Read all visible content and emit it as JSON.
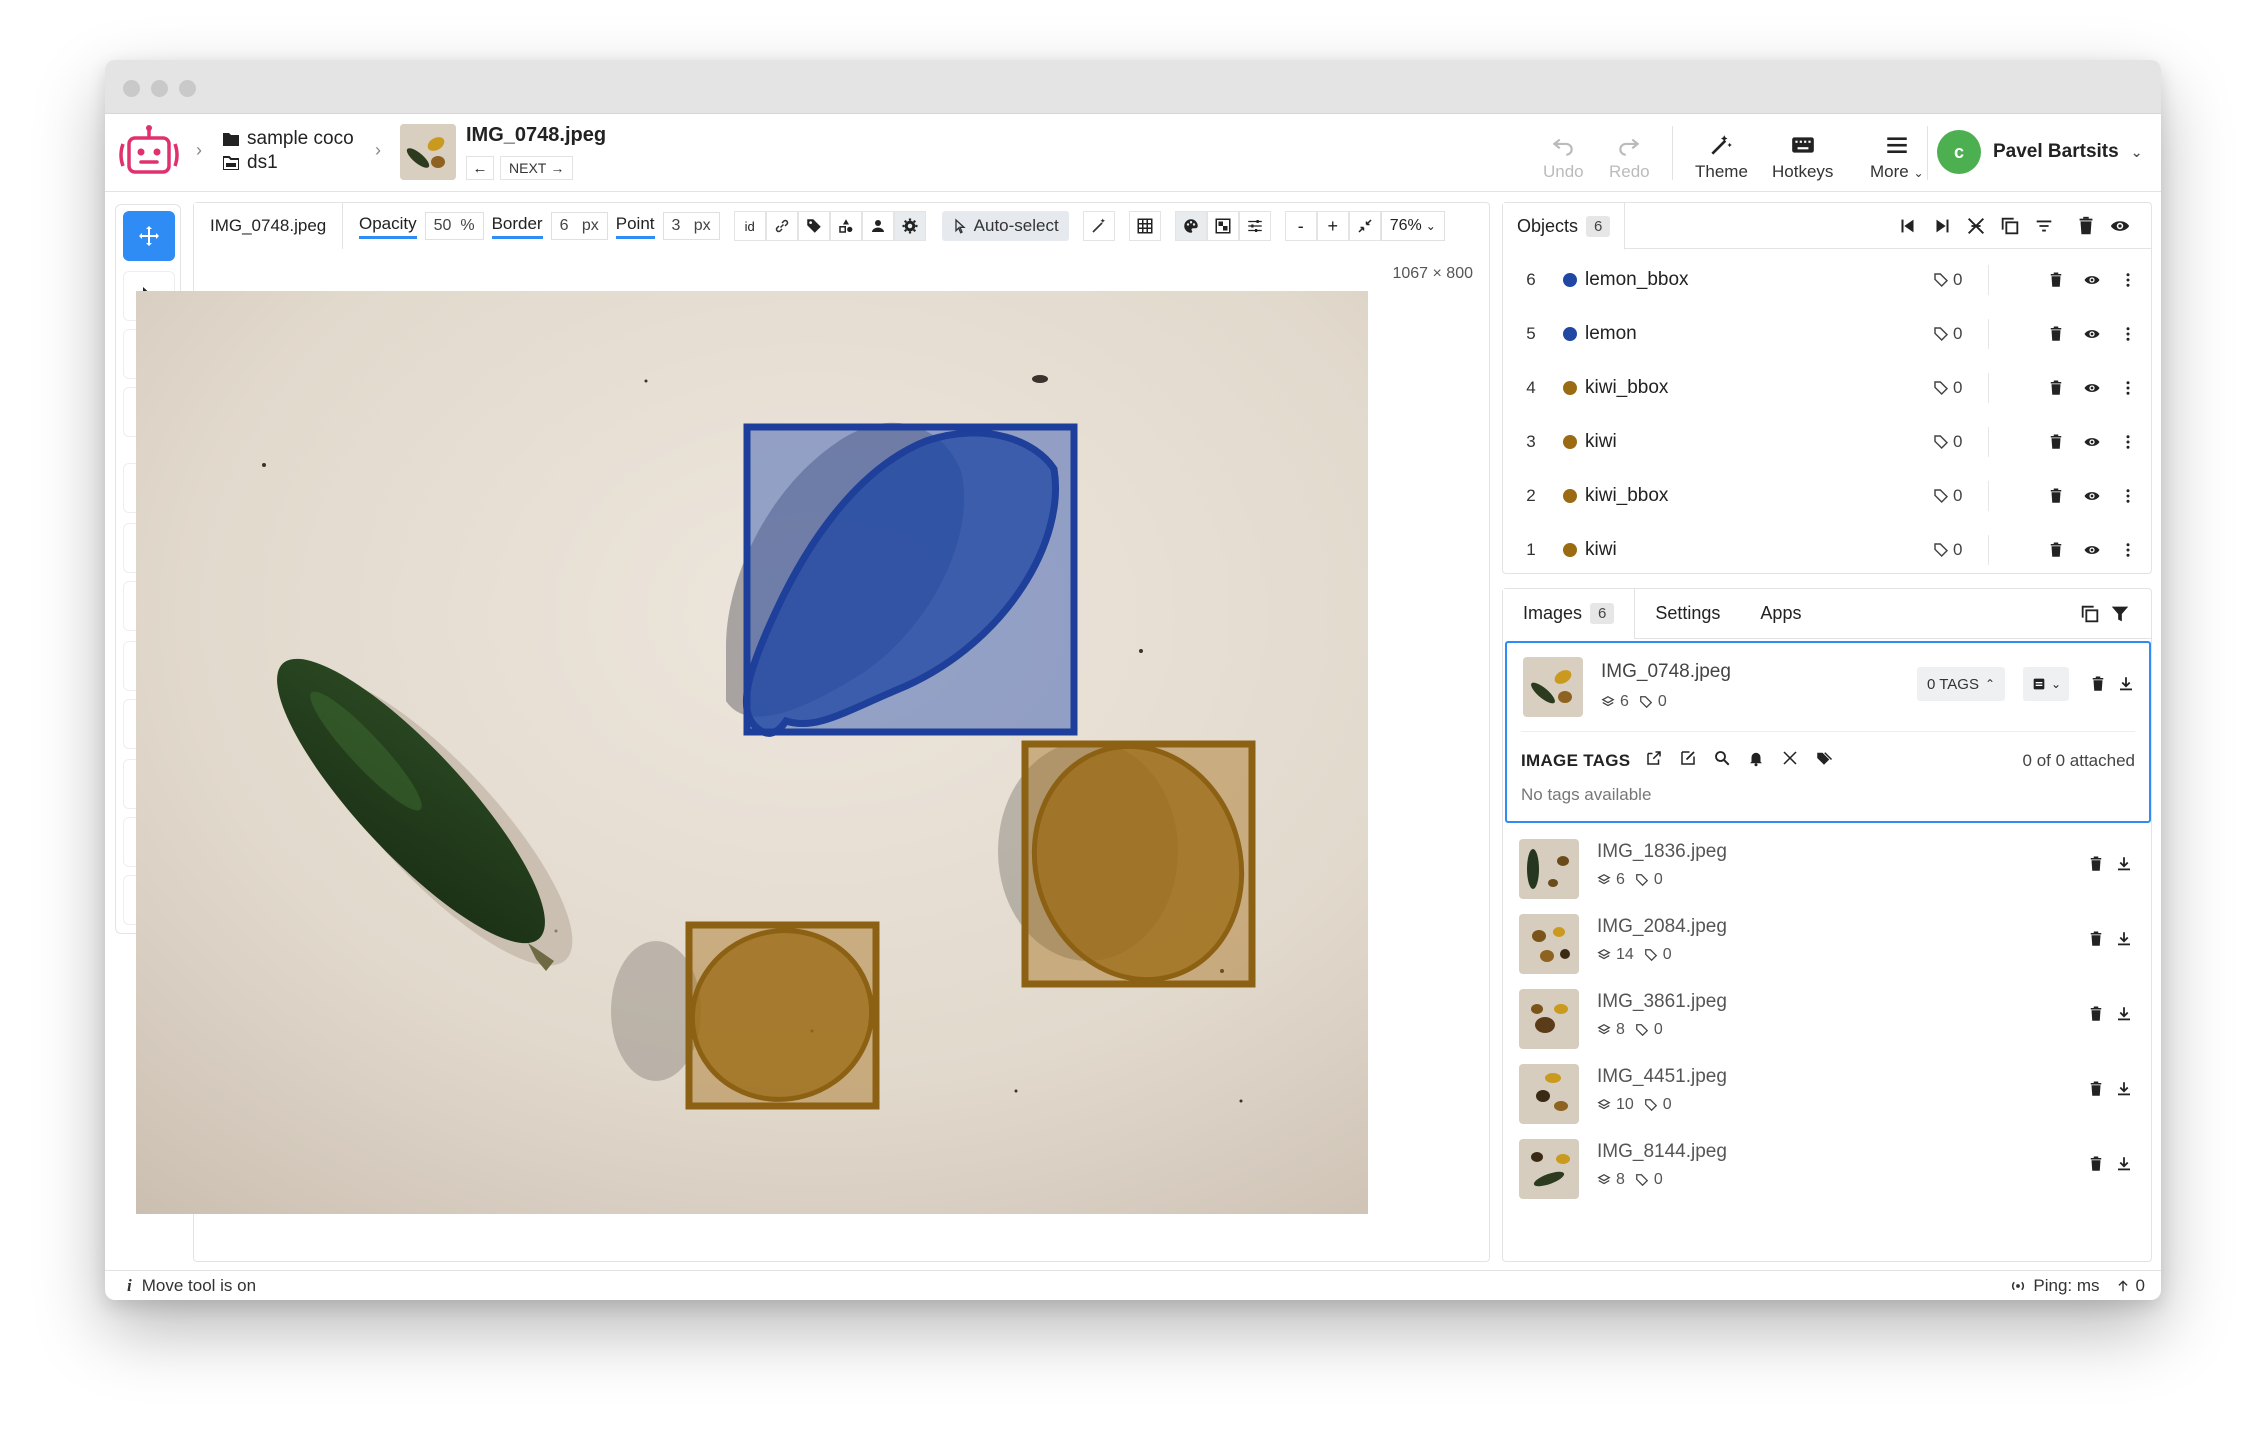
{
  "header": {
    "dataset_project": "sample coco",
    "dataset": "ds1",
    "image_name": "IMG_0748.jpeg",
    "next_label": "NEXT",
    "undo_label": "Undo",
    "redo_label": "Redo",
    "theme_label": "Theme",
    "hotkeys_label": "Hotkeys",
    "more_label": "More",
    "user_initial": "c",
    "user_name": "Pavel Bartsits"
  },
  "canvas_toolbar": {
    "image_tab": "IMG_0748.jpeg",
    "opacity_label": "Opacity",
    "opacity_value": "50",
    "opacity_unit": "%",
    "border_label": "Border",
    "border_value": "6",
    "border_unit": "px",
    "point_label": "Point",
    "point_value": "3",
    "point_unit": "px",
    "id_label": "id",
    "auto_select_label": "Auto-select",
    "zoom_minus": "-",
    "zoom_plus": "+",
    "zoom_value": "76%"
  },
  "canvas": {
    "dimensions": "1067 × 800"
  },
  "objects_panel": {
    "title": "Objects",
    "count": "6",
    "items": [
      {
        "num": "6",
        "name": "lemon_bbox",
        "color": "#1f47a3",
        "tags": "0"
      },
      {
        "num": "5",
        "name": "lemon",
        "color": "#1f47a3",
        "tags": "0"
      },
      {
        "num": "4",
        "name": "kiwi_bbox",
        "color": "#9b6b14",
        "tags": "0"
      },
      {
        "num": "3",
        "name": "kiwi",
        "color": "#9b6b14",
        "tags": "0"
      },
      {
        "num": "2",
        "name": "kiwi_bbox",
        "color": "#9b6b14",
        "tags": "0"
      },
      {
        "num": "1",
        "name": "kiwi",
        "color": "#9b6b14",
        "tags": "0"
      }
    ]
  },
  "images_panel": {
    "tab_images": "Images",
    "images_count": "6",
    "tab_settings": "Settings",
    "tab_apps": "Apps",
    "selected": {
      "name": "IMG_0748.jpeg",
      "objects": "6",
      "tags": "0",
      "tags_button": "0 TAGS",
      "image_tags_label": "IMAGE TAGS",
      "attached": "0 of 0 attached",
      "no_tags": "No tags available"
    },
    "list": [
      {
        "name": "IMG_1836.jpeg",
        "objects": "6",
        "tags": "0"
      },
      {
        "name": "IMG_2084.jpeg",
        "objects": "14",
        "tags": "0"
      },
      {
        "name": "IMG_3861.jpeg",
        "objects": "8",
        "tags": "0"
      },
      {
        "name": "IMG_4451.jpeg",
        "objects": "10",
        "tags": "0"
      },
      {
        "name": "IMG_8144.jpeg",
        "objects": "8",
        "tags": "0"
      }
    ]
  },
  "status": {
    "info_icon": "i",
    "message": "Move tool is on",
    "ping": "Ping: ms",
    "uploads": "0"
  },
  "colors": {
    "accent": "#2f8cf5",
    "lemon": "#1f47a3",
    "kiwi": "#9b6b14",
    "avatar": "#4caf50"
  }
}
